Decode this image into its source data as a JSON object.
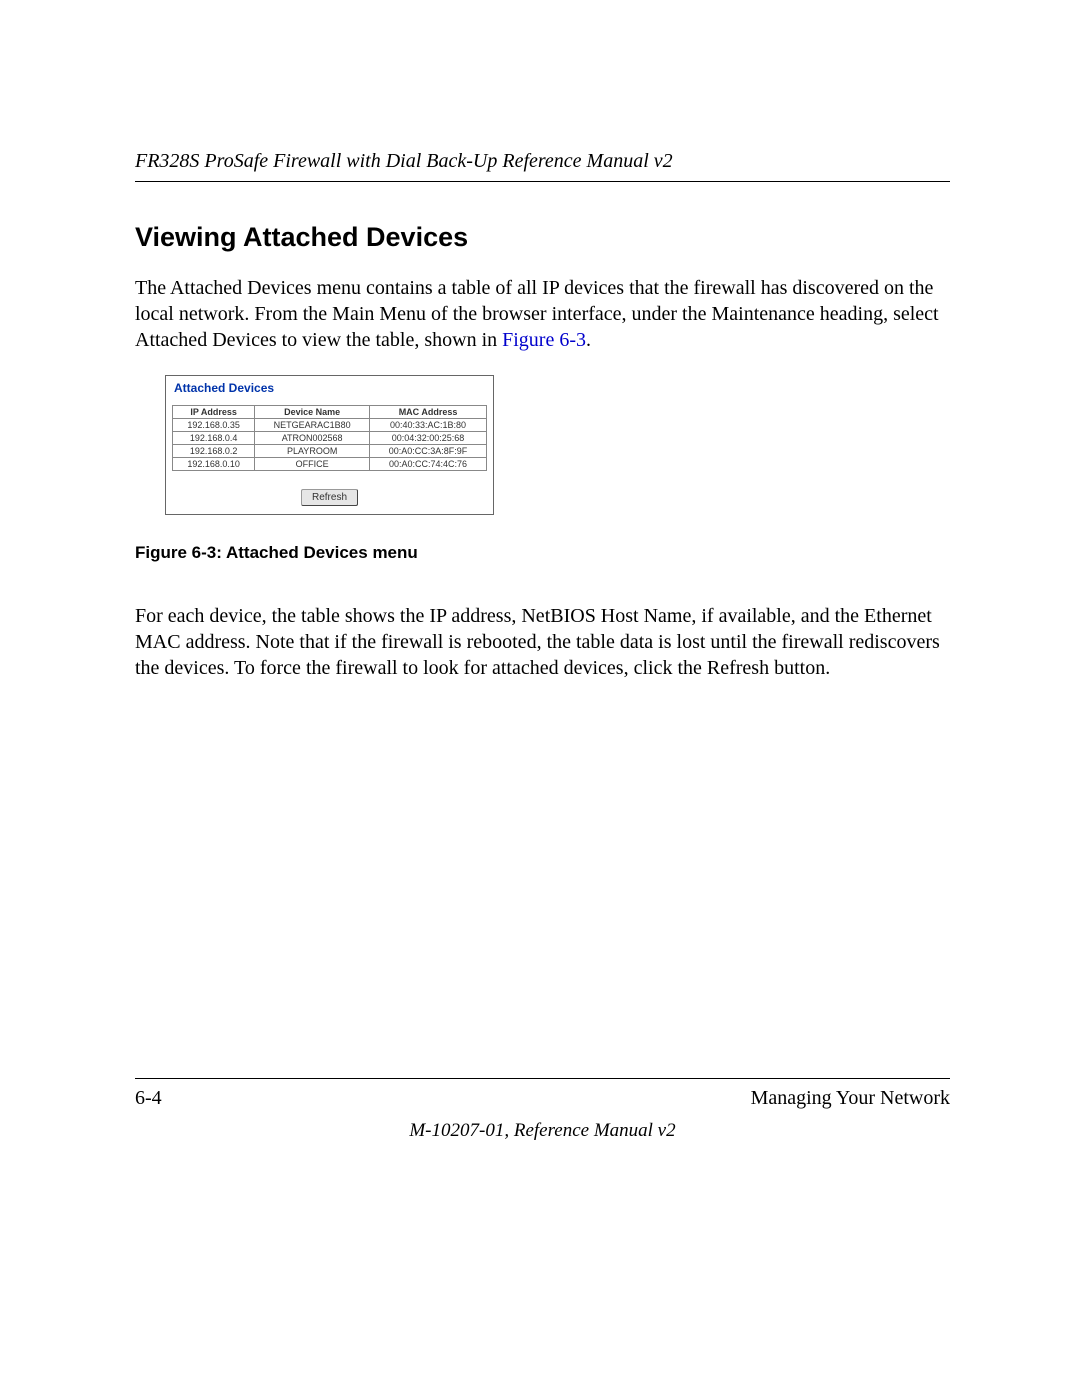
{
  "header": {
    "title": "FR328S ProSafe Firewall with Dial Back-Up Reference Manual v2"
  },
  "section": {
    "heading": "Viewing Attached Devices",
    "para1_a": "The Attached Devices menu contains a table of all IP devices that the firewall has discovered on the local network. From the Main Menu of the browser interface, under the Maintenance heading, select Attached Devices to view the table, shown in ",
    "para1_link": "Figure 6-3",
    "para1_b": ".",
    "para2": "For each device, the table shows the IP address, NetBIOS Host Name, if available, and the Ethernet MAC address. Note that if the firewall is rebooted, the table data is lost until the firewall rediscovers the devices. To force the firewall to look for attached devices, click the Refresh button."
  },
  "figure": {
    "caption": "Figure 6-3: Attached Devices menu"
  },
  "ui": {
    "title": "Attached Devices",
    "columns": {
      "ip": "IP Address",
      "name": "Device Name",
      "mac": "MAC Address"
    },
    "rows": [
      {
        "ip": "192.168.0.35",
        "name": "NETGEARAC1B80",
        "mac": "00:40:33:AC:1B:80"
      },
      {
        "ip": "192.168.0.4",
        "name": "ATRON002568",
        "mac": "00:04:32:00:25:68"
      },
      {
        "ip": "192.168.0.2",
        "name": "PLAYROOM",
        "mac": "00:A0:CC:3A:8F:9F"
      },
      {
        "ip": "192.168.0.10",
        "name": "OFFICE",
        "mac": "00:A0:CC:74:4C:76"
      }
    ],
    "refresh_label": "Refresh"
  },
  "footer": {
    "page_num": "6-4",
    "chapter": "Managing Your Network",
    "doc_id": "M-10207-01, Reference Manual v2"
  }
}
